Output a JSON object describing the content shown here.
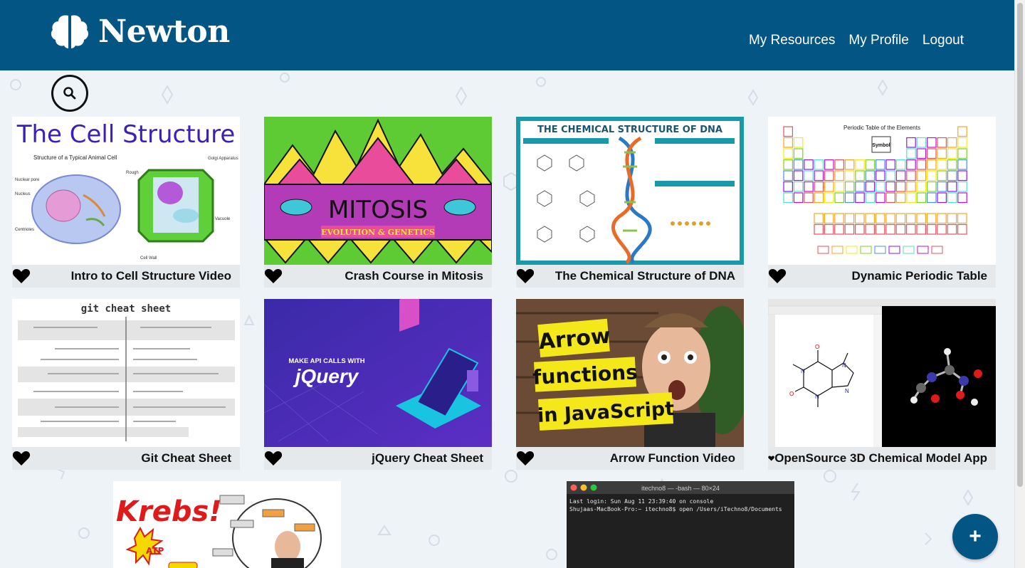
{
  "app": {
    "brand_name": "Newton",
    "brand_color": "#035583"
  },
  "nav": {
    "items": [
      {
        "label": "My Resources"
      },
      {
        "label": "My Profile"
      },
      {
        "label": "Logout"
      }
    ]
  },
  "search": {
    "icon": "search-icon"
  },
  "cards": [
    {
      "title": "Intro to Cell Structure Video",
      "thumb_heading": "The Cell Structure",
      "thumb_caption": "Structure of a Typical Animal Cell"
    },
    {
      "title": "Crash Course in Mitosis",
      "thumb_heading": "MITOSIS",
      "thumb_caption": "EVOLUTION & GENETICS"
    },
    {
      "title": "The Chemical Structure of DNA",
      "thumb_heading": "THE CHEMICAL STRUCTURE OF DNA",
      "thumb_caption": ""
    },
    {
      "title": "Dynamic Periodic Table",
      "thumb_heading": "Periodic Table of the Elements",
      "thumb_caption": "Symbol"
    },
    {
      "title": "Git Cheat Sheet",
      "thumb_heading": "git cheat sheet",
      "thumb_caption": ""
    },
    {
      "title": "jQuery Cheat Sheet",
      "thumb_heading": "jQuery",
      "thumb_caption": "MAKE API CALLS WITH"
    },
    {
      "title": "Arrow Function Video",
      "thumb_heading": "Arrow",
      "thumb_caption": "functions",
      "thumb_caption2": "in JavaScript"
    },
    {
      "title": "OpenSource 3D Chemical Model App",
      "thumb_heading": "",
      "thumb_caption": ""
    }
  ],
  "partial_cards": [
    {
      "thumb_heading": "Krebs!",
      "thumb_caption": "ATP"
    },
    {
      "thumb_heading": "itechno8 — -bash — 80×24",
      "thumb_caption": "Last login: Sun Aug 11 23:39:40 on console",
      "thumb_caption2": "Shujaas-MacBook-Pro:~ itechno8$ open /Users/iTechno8/Documents"
    }
  ],
  "fab": {
    "label": "+"
  }
}
